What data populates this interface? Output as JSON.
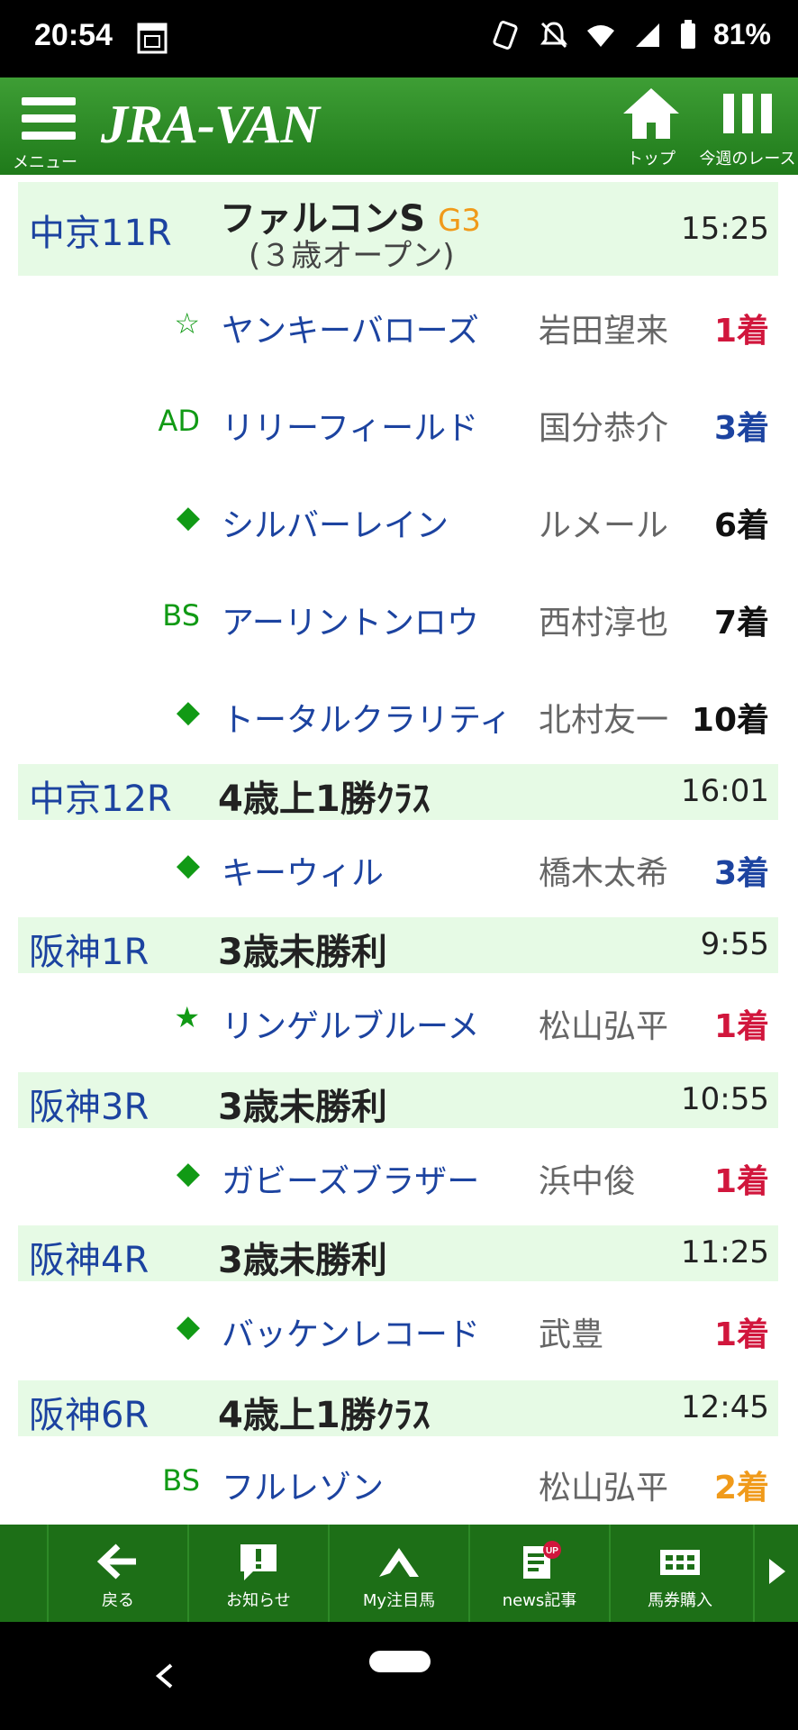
{
  "status_bar": {
    "time": "20:54",
    "battery": "81%",
    "icons": [
      "calendar-icon",
      "nfc-icon",
      "mute-icon",
      "wifi-icon",
      "signal-icon",
      "battery-icon"
    ]
  },
  "app_bar": {
    "menu_label": "メニュー",
    "logo": "JRA-VAN",
    "top_label": "トップ",
    "week_label": "今週のレース"
  },
  "races": [
    {
      "place": "中京11R",
      "name": "ファルコンS",
      "grade": "G3",
      "sub": "(３歳オープン)",
      "time": "15:25",
      "horses": [
        {
          "mark": "☆",
          "horse": "ヤンキーバローズ",
          "jockey": "岩田望来",
          "result": "1着"
        },
        {
          "mark": "AD",
          "horse": "リリーフィールド",
          "jockey": "国分恭介",
          "result": "3着"
        },
        {
          "mark": "◆",
          "horse": "シルバーレイン",
          "jockey": "ルメール",
          "result": "6着"
        },
        {
          "mark": "BS",
          "horse": "アーリントンロウ",
          "jockey": "西村淳也",
          "result": "7着"
        },
        {
          "mark": "◆",
          "horse": "トータルクラリティ",
          "jockey": "北村友一",
          "result": "10着"
        }
      ]
    },
    {
      "place": "中京12R",
      "name": "4歳上1勝ｸﾗｽ",
      "grade": "",
      "sub": "",
      "time": "16:01",
      "horses": [
        {
          "mark": "◆",
          "horse": "キーウィル",
          "jockey": "橋木太希",
          "result": "3着"
        }
      ]
    },
    {
      "place": "阪神1R",
      "name": "3歳未勝利",
      "grade": "",
      "sub": "",
      "time": "9:55",
      "horses": [
        {
          "mark": "★",
          "horse": "リンゲルブルーメ",
          "jockey": "松山弘平",
          "result": "1着"
        }
      ]
    },
    {
      "place": "阪神3R",
      "name": "3歳未勝利",
      "grade": "",
      "sub": "",
      "time": "10:55",
      "horses": [
        {
          "mark": "◆",
          "horse": "ガビーズブラザー",
          "jockey": "浜中俊",
          "result": "1着"
        }
      ]
    },
    {
      "place": "阪神4R",
      "name": "3歳未勝利",
      "grade": "",
      "sub": "",
      "time": "11:25",
      "horses": [
        {
          "mark": "◆",
          "horse": "バッケンレコード",
          "jockey": "武豊",
          "result": "1着"
        }
      ]
    },
    {
      "place": "阪神6R",
      "name": "4歳上1勝ｸﾗｽ",
      "grade": "",
      "sub": "",
      "time": "12:45",
      "horses": [
        {
          "mark": "BS",
          "horse": "フルレゾン",
          "jockey": "松山弘平",
          "result": "2着"
        }
      ]
    }
  ],
  "bottom_nav": [
    {
      "label": "戻る",
      "icon": "back-arrow-icon"
    },
    {
      "label": "お知らせ",
      "icon": "notice-icon"
    },
    {
      "label": "My注目馬",
      "icon": "my-horse-icon"
    },
    {
      "label": "news記事",
      "icon": "news-icon",
      "badge": "UP"
    },
    {
      "label": "馬券購入",
      "icon": "ticket-icon"
    }
  ],
  "colors": {
    "header_green": "#2a8a22",
    "race_header_bg": "#e6fae5",
    "place_blue": "#1c43a0",
    "mark_green": "#119a15",
    "result_first": "#d1163c",
    "result_third": "#1c43a0",
    "result_second": "#f09a1a",
    "result_other": "#111111",
    "grade_orange": "#f09a1a"
  }
}
